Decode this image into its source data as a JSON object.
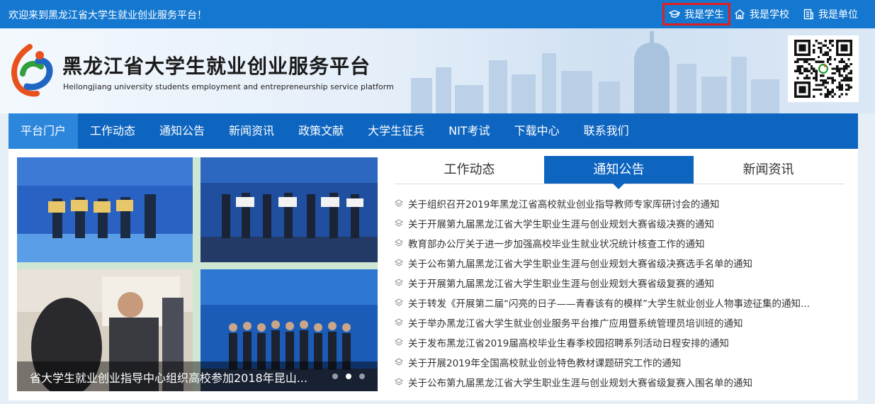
{
  "topbar": {
    "welcome": "欢迎来到黑龙江省大学生就业创业服务平台！",
    "links": [
      {
        "label": "我是学生",
        "icon": "graduate-cap-icon"
      },
      {
        "label": "我是学校",
        "icon": "school-house-icon"
      },
      {
        "label": "我是单位",
        "icon": "building-document-icon"
      }
    ]
  },
  "header": {
    "title": "黑龙江省大学生就业创业服务平台",
    "subtitle": "Heilongjiang university students employment and entrepreneurship service platform",
    "qr_icon": "qr-code-icon"
  },
  "colors": {
    "topbar": "#1478d0",
    "nav": "#0e65c0",
    "nav_active": "#2b86dc",
    "highlight_border": "#e0201e"
  },
  "nav": {
    "items": [
      "平台门户",
      "工作动态",
      "通知公告",
      "新闻资讯",
      "政策文献",
      "大学生征兵",
      "NIT考试",
      "下载中心",
      "联系我们"
    ],
    "active_index": 0
  },
  "slider": {
    "caption": "省大学生就业创业指导中心组织高校参加2018年昆山...",
    "dot_count": 3,
    "active_dot": 1
  },
  "tabs": {
    "items": [
      "工作动态",
      "通知公告",
      "新闻资讯"
    ],
    "active_index": 1
  },
  "news": [
    "关于组织召开2019年黑龙江省高校就业创业指导教师专家库研讨会的通知",
    "关于开展第九届黑龙江省大学生职业生涯与创业规划大赛省级决赛的通知",
    "教育部办公厅关于进一步加强高校毕业生就业状况统计核查工作的通知",
    "关于公布第九届黑龙江省大学生职业生涯与创业规划大赛省级决赛选手名单的通知",
    "关于开展第九届黑龙江省大学生职业生涯与创业规划大赛省级复赛的通知",
    "关于转发《开展第二届“闪亮的日子——青春该有的模样”大学生就业创业人物事迹征集的通知...",
    "关于举办黑龙江省大学生就业创业服务平台推广应用暨系统管理员培训班的通知",
    "关于发布黑龙江省2019届高校毕业生春季校园招聘系列活动日程安排的通知",
    "关于开展2019年全国高校就业创业特色教材课题研究工作的通知",
    "关于公布第九届黑龙江省大学生职业生涯与创业规划大赛省级复赛入围名单的通知"
  ]
}
